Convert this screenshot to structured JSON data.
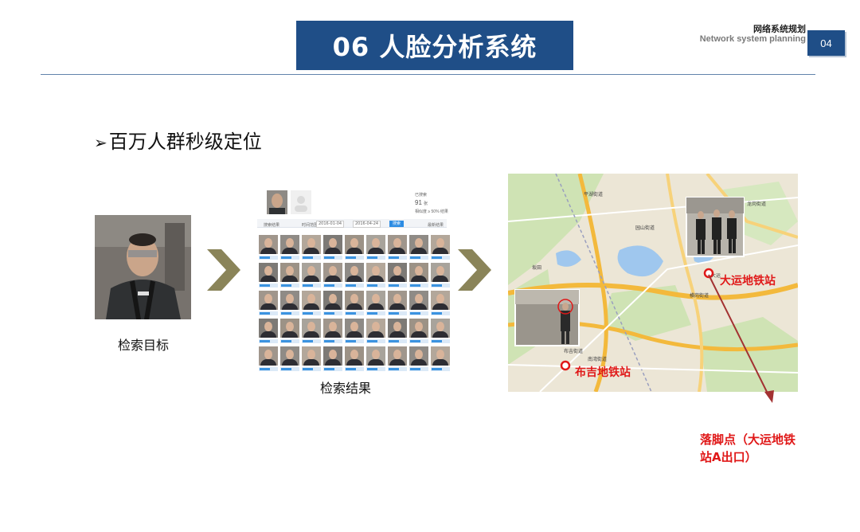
{
  "slide": {
    "title": "06 人脸分析系统",
    "header_cn": "网络系统规划",
    "header_en": "Network system planning",
    "page_number": "04",
    "bullet": "百万人群秒级定位"
  },
  "steps": {
    "target_caption": "检索目标",
    "results_caption": "检索结果"
  },
  "results_panel": {
    "count_label": "已搜索",
    "count_value": "91",
    "count_unit": "张",
    "similarity_text": "相似度 ≥ 50% 结果",
    "filter_label": "搜索结果",
    "time_label": "时间范围",
    "date_start": "2016-01-04",
    "date_end": "2016-04-24",
    "search_button": "搜索",
    "sort_label": "最新结果"
  },
  "map": {
    "station_a": "大运地铁站",
    "station_b": "布吉地铁站",
    "place_labels": [
      "横岗街道",
      "龙岗街道",
      "布吉街道",
      "南湾街道",
      "坂田",
      "平湖街道",
      "园山街道",
      "大运"
    ]
  },
  "note": {
    "line1": "落脚点（大运地铁",
    "line2": "站A出口）"
  },
  "colors": {
    "title_bg": "#1f4e87",
    "arrow": "#8a8459",
    "annotation": "#e01818"
  }
}
